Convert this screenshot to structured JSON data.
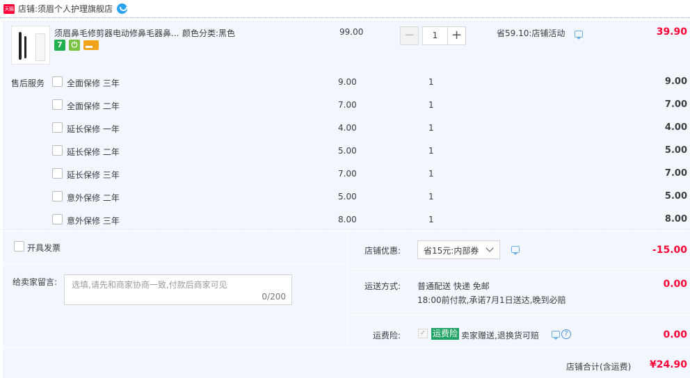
{
  "shop": {
    "badge": "天猫",
    "label": "店铺:",
    "name": "须眉个人护理旗舰店"
  },
  "item": {
    "title": "须眉鼻毛修剪器电动修鼻毛器鼻...",
    "sku": "颜色分类:黑色",
    "tags": [
      {
        "icon": "seven-day-return-icon",
        "text": "7",
        "color": "#21b050"
      },
      {
        "icon": "plug-icon",
        "color": "#7ac143"
      },
      {
        "icon": "credit-card-icon",
        "color": "#f0a319"
      }
    ],
    "unit_price": "99.00",
    "quantity": "1",
    "promo": "省59.10:店铺活动",
    "total": "39.90"
  },
  "services": {
    "label": "售后服务",
    "rows": [
      {
        "name": "全面保修 三年",
        "price": "9.00",
        "qty": "1",
        "total": "9.00"
      },
      {
        "name": "全面保修 二年",
        "price": "7.00",
        "qty": "1",
        "total": "7.00"
      },
      {
        "name": "延长保修 一年",
        "price": "4.00",
        "qty": "1",
        "total": "4.00"
      },
      {
        "name": "延长保修 二年",
        "price": "5.00",
        "qty": "1",
        "total": "5.00"
      },
      {
        "name": "延长保修 三年",
        "price": "7.00",
        "qty": "1",
        "total": "7.00"
      },
      {
        "name": "意外保修 二年",
        "price": "5.00",
        "qty": "1",
        "total": "5.00"
      },
      {
        "name": "意外保修 三年",
        "price": "8.00",
        "qty": "1",
        "total": "8.00"
      }
    ]
  },
  "invoice": {
    "label": "开具发票"
  },
  "note": {
    "label": "给卖家留言:",
    "placeholder": "选填,请先和商家协商一致,付款后商家可见",
    "count": "0/200"
  },
  "coupon": {
    "label": "店铺优惠:",
    "selected": "省15元:内部券",
    "amount": "-15.00"
  },
  "shipping": {
    "label": "运送方式:",
    "method": "普通配送 快递 免邮",
    "note": "18:00前付款,承诺7月1日送达,晚到必赔",
    "amount": "0.00"
  },
  "insurance": {
    "label": "运费险:",
    "badge": "运费险",
    "text": "卖家赠送,退换货可赔",
    "amount": "0.00"
  },
  "summary": {
    "label": "店铺合计(含运费)",
    "amount": "¥24.90"
  },
  "colors": {
    "accent_red": "#ff0036",
    "panel_bg": "#f2f7ff",
    "insurance_green": "#21a366"
  }
}
